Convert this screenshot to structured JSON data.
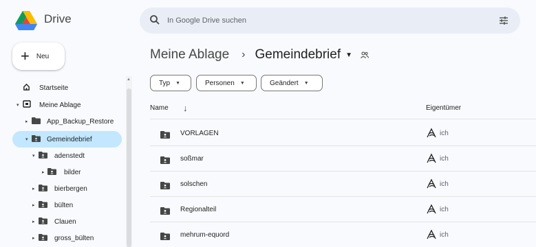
{
  "app": {
    "title": "Drive",
    "logo_icon": "google-drive-logo"
  },
  "search": {
    "placeholder": "In Google Drive suchen",
    "value": ""
  },
  "new_button": {
    "label": "Neu"
  },
  "sidebar": {
    "items": [
      {
        "label": "Startseite",
        "icon": "home-icon"
      },
      {
        "label": "Meine Ablage",
        "icon": "my-drive-icon"
      },
      {
        "label": "App_Backup_Restore",
        "icon": "folder-icon"
      },
      {
        "label": "Gemeindebrief",
        "icon": "shared-folder-icon",
        "selected": true
      },
      {
        "label": "adenstedt",
        "icon": "shared-folder-icon"
      },
      {
        "label": "bilder",
        "icon": "shared-folder-icon"
      },
      {
        "label": "bierbergen",
        "icon": "shared-folder-icon"
      },
      {
        "label": "bülten",
        "icon": "shared-folder-icon"
      },
      {
        "label": "Clauen",
        "icon": "shared-folder-icon"
      },
      {
        "label": "gross_bülten",
        "icon": "shared-folder-icon"
      }
    ]
  },
  "breadcrumb": {
    "parent": "Meine Ablage",
    "separator": "›",
    "current": "Gemeindebrief"
  },
  "filters": [
    "Typ",
    "Personen",
    "Geändert"
  ],
  "table": {
    "columns": {
      "name": "Name",
      "owner": "Eigentümer"
    },
    "sort_direction": "down",
    "rows": [
      {
        "name": "VORLAGEN",
        "owner": "ich"
      },
      {
        "name": "soßmar",
        "owner": "ich"
      },
      {
        "name": "solschen",
        "owner": "ich"
      },
      {
        "name": "Regionalteil",
        "owner": "ich"
      },
      {
        "name": "mehrum-equord",
        "owner": "ich"
      }
    ]
  },
  "colors": {
    "accent_selected": "#c2e7ff",
    "search_bg": "#e9eef6",
    "background": "#f8fafd"
  }
}
